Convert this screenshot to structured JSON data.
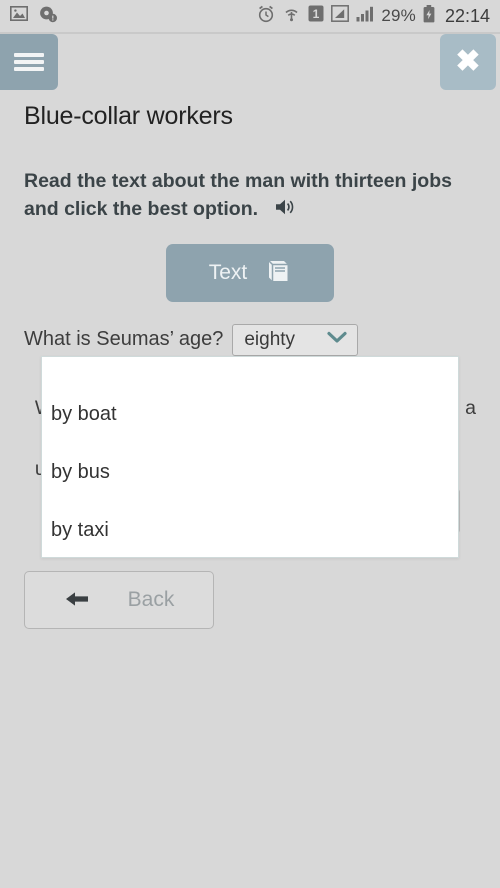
{
  "statusbar": {
    "left_icons": [
      "image-icon",
      "sync-badge-icon"
    ],
    "right_icons": [
      "alarm-icon",
      "wifi-icon",
      "sim-1-icon",
      "signal-weak-icon",
      "signal-icon"
    ],
    "battery_percent": "29%",
    "battery_icon": "battery-charging-icon",
    "time": "22:14"
  },
  "header": {
    "menu_icon": "hamburger-menu-icon",
    "close_icon": "close-icon",
    "menu_color": "#8ea3ae",
    "close_color": "#a8bcc6"
  },
  "page": {
    "title": "Blue-collar workers",
    "instruction": "Read the text about the man with thirteen jobs and click the best option.",
    "audio_icon": "speaker-icon"
  },
  "text_button": {
    "label": "Text",
    "icon": "book-icon",
    "bg": "#8ea3ae"
  },
  "question_one": {
    "label": "What is Seumas’ age?",
    "selected_value": "eighty",
    "chevron_icon": "chevron-down-icon",
    "chevron_color": "#5e8b8e"
  },
  "hidden_text": {
    "line1_start": "W",
    "line1_end": "a",
    "line2_start": "u"
  },
  "dropdown": {
    "options": [
      {
        "label": "by boat"
      },
      {
        "label": "by bus"
      },
      {
        "label": "by taxi"
      }
    ]
  },
  "back_button": {
    "label": "Back",
    "icon": "arrow-left-icon"
  }
}
